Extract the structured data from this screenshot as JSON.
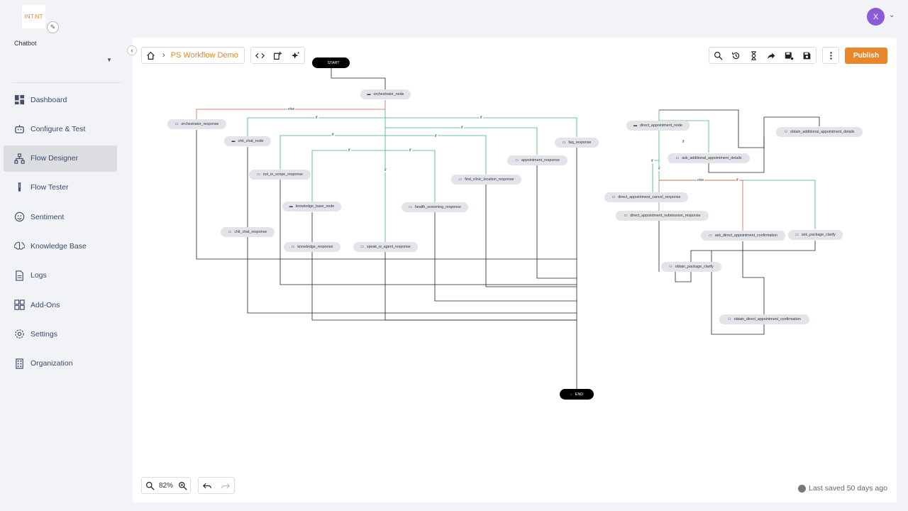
{
  "logo": {
    "text": "INT:NT"
  },
  "chatbot_label": "Chatbot",
  "user": {
    "initial": "X"
  },
  "nav": [
    {
      "label": "Dashboard",
      "icon": "dashboard-icon"
    },
    {
      "label": "Configure & Test",
      "icon": "robot-icon"
    },
    {
      "label": "Flow Designer",
      "icon": "flow-icon",
      "active": true
    },
    {
      "label": "Flow Tester",
      "icon": "test-tube-icon"
    },
    {
      "label": "Sentiment",
      "icon": "smiley-icon"
    },
    {
      "label": "Knowledge Base",
      "icon": "brain-icon"
    },
    {
      "label": "Logs",
      "icon": "document-icon"
    },
    {
      "label": "Add-Ons",
      "icon": "grid-plus-icon"
    },
    {
      "label": "Settings",
      "icon": "gear-icon"
    },
    {
      "label": "Organization",
      "icon": "building-icon"
    }
  ],
  "breadcrumb": {
    "current": "PS Workflow Demo"
  },
  "toolbar": {
    "publish_label": "Publish"
  },
  "zoom": {
    "value": "82%"
  },
  "status": {
    "last_saved": "Last saved 50 days ago"
  },
  "flow": {
    "nodes": {
      "start": "START",
      "end": "END",
      "orchestrator_node": "orchestrator_node",
      "orchestrator_response": "orchestrator_response",
      "chit_chat_node": "chit_chat_node",
      "not_in_scope_response": "not_in_scope_response",
      "knowledge_base_node": "knowledge_base_node",
      "knowledge_response": "knowledge_response",
      "chit_chat_response": "chit_chat_response",
      "speak_w_agent_response": "speak_w_agent_response",
      "health_screening_response": "health_screening_response",
      "find_clinic_location_response": "find_clinic_location_response",
      "appointment_response": "appointment_response",
      "faq_response": "faq_response",
      "direct_appointment_node": "direct_appointment_node",
      "obtain_additional_appointment_details": "obtain_additional_appointment_details",
      "ask_additional_appointment_details": "ask_additional_appointment_details",
      "direct_appointment_cancel_response": "direct_appointment_cancel_response",
      "direct_appointment_submission_response": "direct_appointment_submission_response",
      "ask_direct_appointment_confirmation": "ask_direct_appointment_confirmation",
      "ask_package_clarify": "ask_package_clarify",
      "obtain_package_clarify": "obtain_package_clarify",
      "obtain_direct_appointment_confirmation": "obtain_direct_appointment_confirmation"
    },
    "edge_labels": {
      "else": "else",
      "if": "if"
    }
  }
}
